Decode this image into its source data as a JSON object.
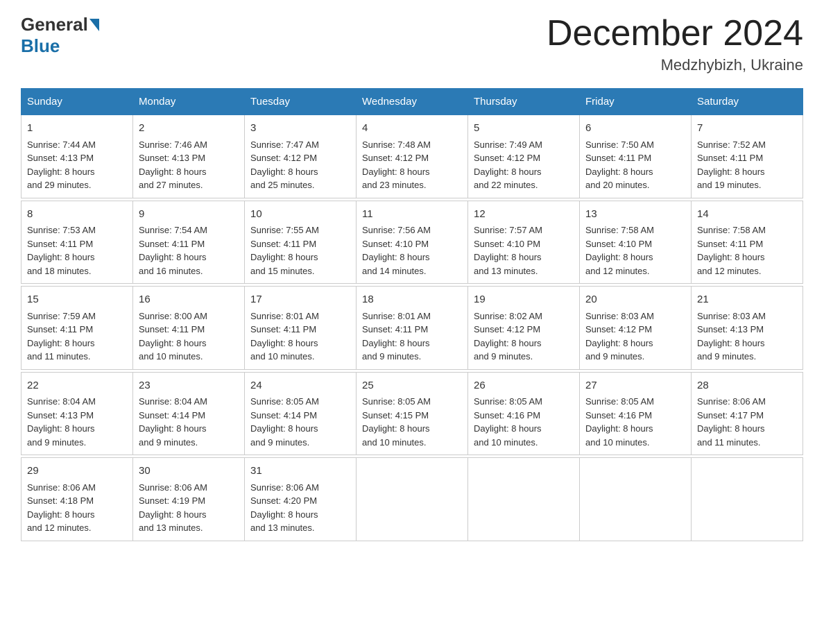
{
  "logo": {
    "general": "General",
    "blue": "Blue"
  },
  "title": "December 2024",
  "location": "Medzhybizh, Ukraine",
  "days_of_week": [
    "Sunday",
    "Monday",
    "Tuesday",
    "Wednesday",
    "Thursday",
    "Friday",
    "Saturday"
  ],
  "weeks": [
    [
      {
        "day": "1",
        "info": "Sunrise: 7:44 AM\nSunset: 4:13 PM\nDaylight: 8 hours\nand 29 minutes."
      },
      {
        "day": "2",
        "info": "Sunrise: 7:46 AM\nSunset: 4:13 PM\nDaylight: 8 hours\nand 27 minutes."
      },
      {
        "day": "3",
        "info": "Sunrise: 7:47 AM\nSunset: 4:12 PM\nDaylight: 8 hours\nand 25 minutes."
      },
      {
        "day": "4",
        "info": "Sunrise: 7:48 AM\nSunset: 4:12 PM\nDaylight: 8 hours\nand 23 minutes."
      },
      {
        "day": "5",
        "info": "Sunrise: 7:49 AM\nSunset: 4:12 PM\nDaylight: 8 hours\nand 22 minutes."
      },
      {
        "day": "6",
        "info": "Sunrise: 7:50 AM\nSunset: 4:11 PM\nDaylight: 8 hours\nand 20 minutes."
      },
      {
        "day": "7",
        "info": "Sunrise: 7:52 AM\nSunset: 4:11 PM\nDaylight: 8 hours\nand 19 minutes."
      }
    ],
    [
      {
        "day": "8",
        "info": "Sunrise: 7:53 AM\nSunset: 4:11 PM\nDaylight: 8 hours\nand 18 minutes."
      },
      {
        "day": "9",
        "info": "Sunrise: 7:54 AM\nSunset: 4:11 PM\nDaylight: 8 hours\nand 16 minutes."
      },
      {
        "day": "10",
        "info": "Sunrise: 7:55 AM\nSunset: 4:11 PM\nDaylight: 8 hours\nand 15 minutes."
      },
      {
        "day": "11",
        "info": "Sunrise: 7:56 AM\nSunset: 4:10 PM\nDaylight: 8 hours\nand 14 minutes."
      },
      {
        "day": "12",
        "info": "Sunrise: 7:57 AM\nSunset: 4:10 PM\nDaylight: 8 hours\nand 13 minutes."
      },
      {
        "day": "13",
        "info": "Sunrise: 7:58 AM\nSunset: 4:10 PM\nDaylight: 8 hours\nand 12 minutes."
      },
      {
        "day": "14",
        "info": "Sunrise: 7:58 AM\nSunset: 4:11 PM\nDaylight: 8 hours\nand 12 minutes."
      }
    ],
    [
      {
        "day": "15",
        "info": "Sunrise: 7:59 AM\nSunset: 4:11 PM\nDaylight: 8 hours\nand 11 minutes."
      },
      {
        "day": "16",
        "info": "Sunrise: 8:00 AM\nSunset: 4:11 PM\nDaylight: 8 hours\nand 10 minutes."
      },
      {
        "day": "17",
        "info": "Sunrise: 8:01 AM\nSunset: 4:11 PM\nDaylight: 8 hours\nand 10 minutes."
      },
      {
        "day": "18",
        "info": "Sunrise: 8:01 AM\nSunset: 4:11 PM\nDaylight: 8 hours\nand 9 minutes."
      },
      {
        "day": "19",
        "info": "Sunrise: 8:02 AM\nSunset: 4:12 PM\nDaylight: 8 hours\nand 9 minutes."
      },
      {
        "day": "20",
        "info": "Sunrise: 8:03 AM\nSunset: 4:12 PM\nDaylight: 8 hours\nand 9 minutes."
      },
      {
        "day": "21",
        "info": "Sunrise: 8:03 AM\nSunset: 4:13 PM\nDaylight: 8 hours\nand 9 minutes."
      }
    ],
    [
      {
        "day": "22",
        "info": "Sunrise: 8:04 AM\nSunset: 4:13 PM\nDaylight: 8 hours\nand 9 minutes."
      },
      {
        "day": "23",
        "info": "Sunrise: 8:04 AM\nSunset: 4:14 PM\nDaylight: 8 hours\nand 9 minutes."
      },
      {
        "day": "24",
        "info": "Sunrise: 8:05 AM\nSunset: 4:14 PM\nDaylight: 8 hours\nand 9 minutes."
      },
      {
        "day": "25",
        "info": "Sunrise: 8:05 AM\nSunset: 4:15 PM\nDaylight: 8 hours\nand 10 minutes."
      },
      {
        "day": "26",
        "info": "Sunrise: 8:05 AM\nSunset: 4:16 PM\nDaylight: 8 hours\nand 10 minutes."
      },
      {
        "day": "27",
        "info": "Sunrise: 8:05 AM\nSunset: 4:16 PM\nDaylight: 8 hours\nand 10 minutes."
      },
      {
        "day": "28",
        "info": "Sunrise: 8:06 AM\nSunset: 4:17 PM\nDaylight: 8 hours\nand 11 minutes."
      }
    ],
    [
      {
        "day": "29",
        "info": "Sunrise: 8:06 AM\nSunset: 4:18 PM\nDaylight: 8 hours\nand 12 minutes."
      },
      {
        "day": "30",
        "info": "Sunrise: 8:06 AM\nSunset: 4:19 PM\nDaylight: 8 hours\nand 13 minutes."
      },
      {
        "day": "31",
        "info": "Sunrise: 8:06 AM\nSunset: 4:20 PM\nDaylight: 8 hours\nand 13 minutes."
      },
      {
        "day": "",
        "info": ""
      },
      {
        "day": "",
        "info": ""
      },
      {
        "day": "",
        "info": ""
      },
      {
        "day": "",
        "info": ""
      }
    ]
  ]
}
